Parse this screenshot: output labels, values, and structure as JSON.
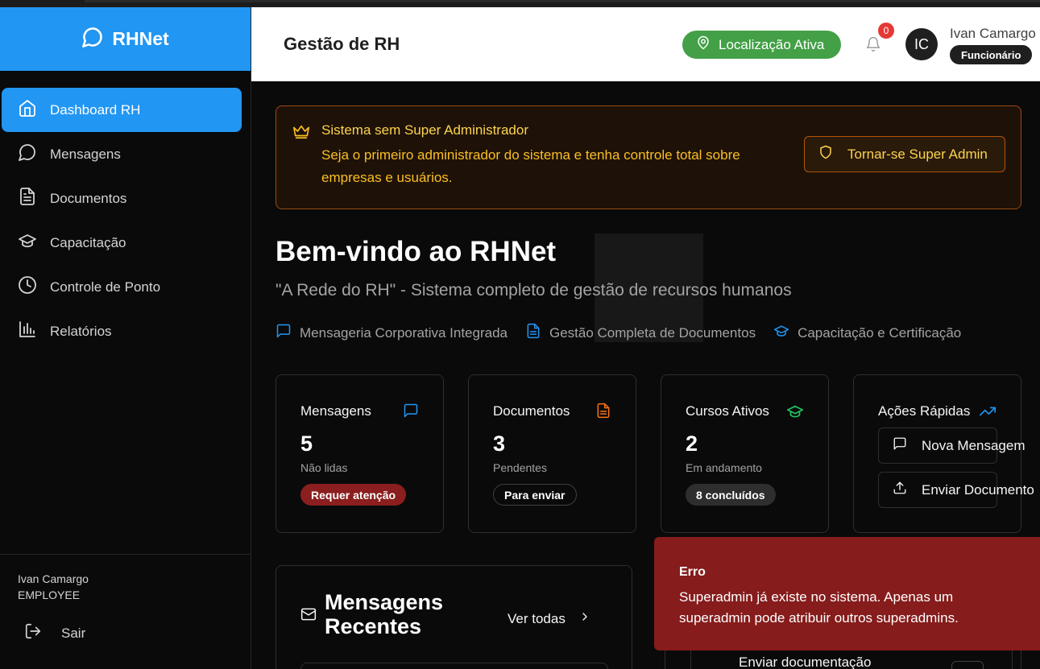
{
  "app": {
    "brand": "RHNet",
    "header_title": "Gestão de RH"
  },
  "colors": {
    "primary": "#2196f3",
    "success": "#43a047",
    "danger": "#861c1c",
    "warning": "#fbbf24"
  },
  "header": {
    "location_badge": "Localização Ativa",
    "notification_count": "0",
    "avatar_initials": "IC",
    "user_name": "Ivan Camargo",
    "user_role": "Funcionário"
  },
  "sidebar": {
    "items": [
      {
        "label": "Dashboard RH",
        "icon": "home-icon",
        "active": true
      },
      {
        "label": "Mensagens",
        "icon": "message-icon"
      },
      {
        "label": "Documentos",
        "icon": "document-icon"
      },
      {
        "label": "Capacitação",
        "icon": "graduation-cap-icon"
      },
      {
        "label": "Controle de Ponto",
        "icon": "clock-icon"
      },
      {
        "label": "Relatórios",
        "icon": "bar-chart-icon"
      }
    ],
    "footer_user_name": "Ivan Camargo",
    "footer_user_role": "EMPLOYEE",
    "logout_label": "Sair"
  },
  "alert": {
    "title": "Sistema sem Super Administrador",
    "description": "Seja o primeiro administrador do sistema e tenha controle total sobre empresas e usuários.",
    "button_label": "Tornar-se Super Admin"
  },
  "welcome": {
    "title": "Bem-vindo ao RHNet",
    "subtitle": "\"A Rede do RH\" - Sistema completo de gestão de recursos humanos",
    "features": [
      "Mensageria Corporativa Integrada",
      "Gestão Completa de Documentos",
      "Capacitação e Certificação"
    ]
  },
  "stats": {
    "messages": {
      "title": "Mensagens",
      "value": "5",
      "label": "Não lidas",
      "badge": "Requer atenção"
    },
    "documents": {
      "title": "Documentos",
      "value": "3",
      "label": "Pendentes",
      "badge": "Para enviar"
    },
    "courses": {
      "title": "Cursos Ativos",
      "value": "2",
      "label": "Em andamento",
      "badge": "8 concluídos"
    },
    "quick_actions": {
      "title": "Ações Rápidas",
      "new_message": "Nova Mensagem",
      "send_document": "Enviar Documento"
    }
  },
  "recent_messages": {
    "title": "Mensagens Recentes",
    "view_all": "Ver todas"
  },
  "pending": {
    "item_text": "Enviar documentação"
  },
  "toast": {
    "title": "Erro",
    "description": "Superadmin já existe no sistema. Apenas um superadmin pode atribuir outros superadmins."
  }
}
